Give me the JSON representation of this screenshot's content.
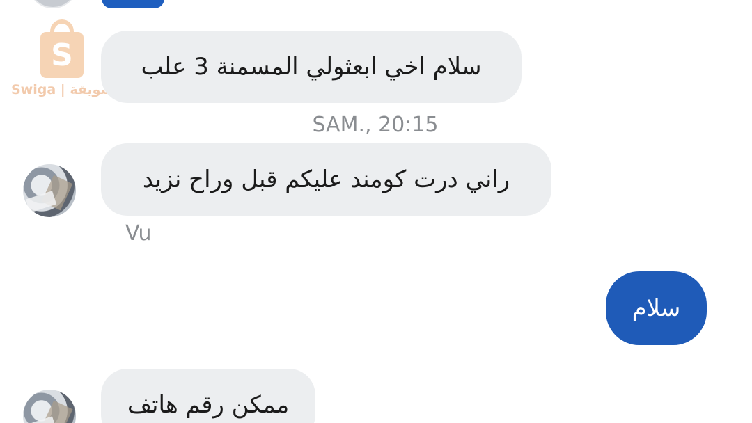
{
  "watermark": {
    "brand": "Swiga | سويقة",
    "logo_letter": "S"
  },
  "messages": [
    {
      "direction": "incoming",
      "text": "سلام اخي ابعثولي  المسمنة 3 علب"
    },
    {
      "direction": "incoming",
      "text": "راني درت كومند عليكم قبل وراح نزيد"
    },
    {
      "direction": "outgoing",
      "text": "سلام"
    },
    {
      "direction": "incoming",
      "text": "ممكن رقم هاتف"
    }
  ],
  "timestamp": "SAM., 20:15",
  "seen_label": "Vu",
  "colors": {
    "incoming_bubble": "#eceef0",
    "outgoing_bubble": "#1f5bb8",
    "meta_text": "#8a8d91",
    "watermark": "#f0b27a"
  }
}
